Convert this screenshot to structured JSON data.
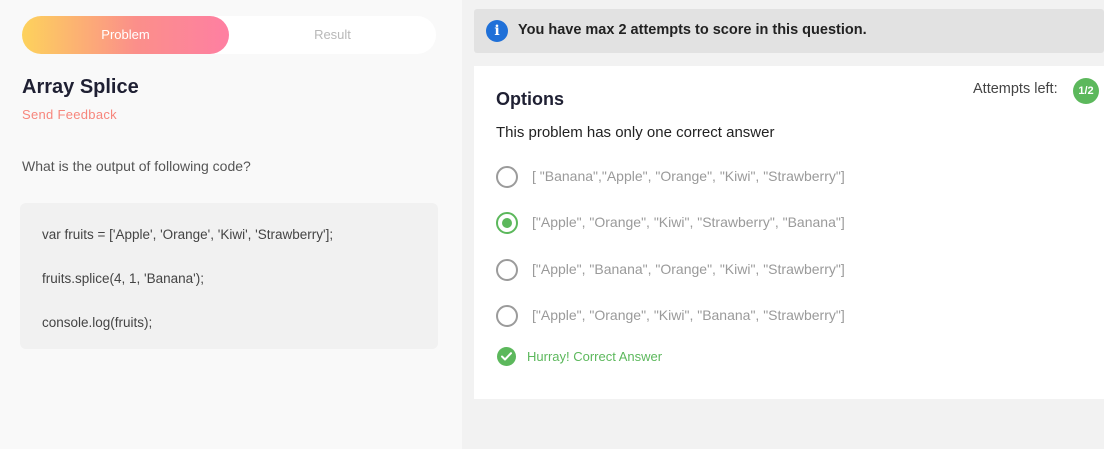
{
  "tabs": {
    "problem_label": "Problem",
    "result_label": "Result"
  },
  "problem": {
    "title": "Array Splice",
    "feedback_link": "Send Feedback",
    "question": "What is the output of following code?",
    "code_lines": [
      "var fruits = ['Apple', 'Orange', 'Kiwi', 'Strawberry'];",
      "fruits.splice(4, 1, 'Banana');",
      "console.log(fruits);"
    ]
  },
  "banner": {
    "icon": "info-icon",
    "text": "You have max 2 attempts to score in this question."
  },
  "options_card": {
    "title": "Options",
    "attempts_label": "Attempts left:",
    "attempts_value": "1/2",
    "subtitle": "This problem has only one correct answer",
    "options": [
      {
        "text": "[ \"Banana\",\"Apple\", \"Orange\", \"Kiwi\", \"Strawberry\"]",
        "selected": false
      },
      {
        "text": "[\"Apple\", \"Orange\", \"Kiwi\", \"Strawberry\", \"Banana\"]",
        "selected": true
      },
      {
        "text": "[\"Apple\", \"Banana\", \"Orange\", \"Kiwi\", \"Strawberry\"]",
        "selected": false
      },
      {
        "text": "[\"Apple\", \"Orange\", \"Kiwi\", \"Banana\", \"Strawberry\"]",
        "selected": false
      }
    ],
    "result_text": "Hurray! Correct Answer",
    "result_icon": "check-circle-icon"
  },
  "colors": {
    "accent_green": "#5cb85c",
    "info_blue": "#1f70d8",
    "feedback_pink": "#f7867c",
    "tab_gradient_start": "#fdd25c",
    "tab_gradient_end": "#fe7fa2"
  }
}
